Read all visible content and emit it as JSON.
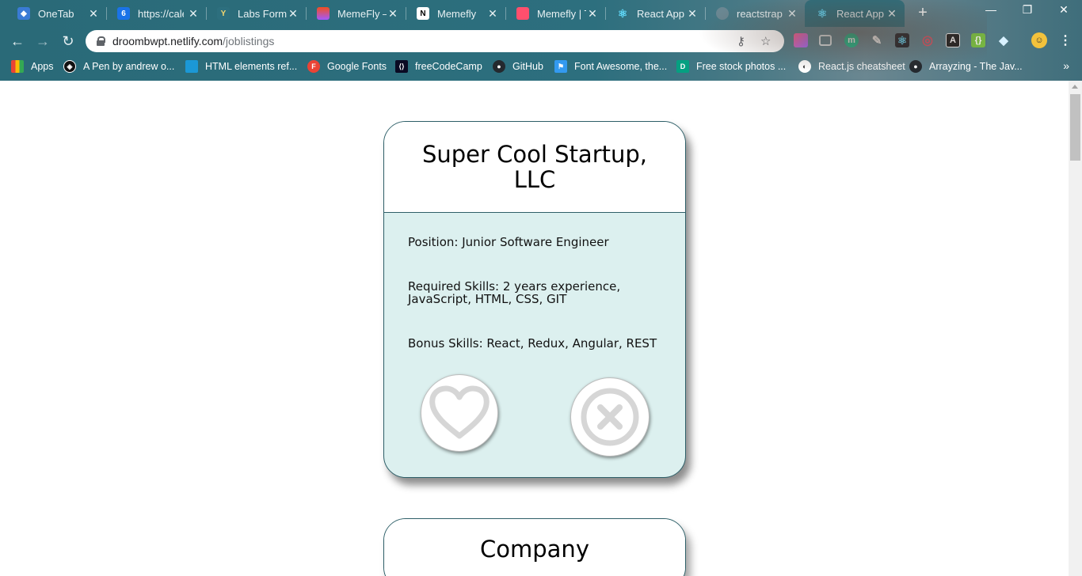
{
  "browser": {
    "tabs": [
      {
        "title": "OneTab",
        "icon": "onetab-icon",
        "color": "#3a7bd5"
      },
      {
        "title": "https://cale",
        "icon": "calendar-icon",
        "color": "#1a73e8",
        "glyph": "6"
      },
      {
        "title": "Labs Forms",
        "icon": "typeform-icon",
        "color": "#2d6f7e",
        "glyph": "Y"
      },
      {
        "title": "MemeFly –",
        "icon": "figma-icon",
        "color": "#e24b2b"
      },
      {
        "title": "Memefly",
        "icon": "notion-icon",
        "color": "#ffffff",
        "glyph": "N"
      },
      {
        "title": "Memefly | T",
        "icon": "trello-icon",
        "color": "#ff4f6d"
      },
      {
        "title": "React App",
        "icon": "react-icon",
        "color": "#61dafb"
      },
      {
        "title": "reactstrap -",
        "icon": "reactstrap-icon",
        "color": "#6a8792"
      },
      {
        "title": "React App",
        "icon": "react-icon",
        "color": "#61dafb"
      }
    ],
    "url_host": "droombwpt.netlify.com",
    "url_path": "/joblistings",
    "bookmarks": [
      {
        "label": "Apps",
        "icon": "apps-grid-icon",
        "color": "#ea4335"
      },
      {
        "label": "A Pen by andrew o...",
        "icon": "codepen-icon",
        "color": "#111111"
      },
      {
        "label": "HTML elements ref...",
        "icon": "mdn-icon",
        "color": "#1b98d6"
      },
      {
        "label": "Google Fonts",
        "icon": "google-fonts-icon",
        "color": "#ea4335",
        "glyph": "F"
      },
      {
        "label": "freeCodeCamp",
        "icon": "freecodecamp-icon",
        "color": "#0a0a23"
      },
      {
        "label": "GitHub",
        "icon": "github-icon",
        "color": "#24292e"
      },
      {
        "label": "Font Awesome, the...",
        "icon": "font-awesome-icon",
        "color": "#339af0"
      },
      {
        "label": "Free stock photos ...",
        "icon": "pexels-icon",
        "color": "#05a081",
        "glyph": "D"
      },
      {
        "label": "React.js cheatsheet",
        "icon": "globe-icon",
        "color": "#5f6368"
      },
      {
        "label": "Arrayzing - The Jav...",
        "icon": "github-icon",
        "color": "#24292e"
      }
    ]
  },
  "cards": [
    {
      "company": "Super Cool Startup, LLC",
      "position": "Position: Junior Software Engineer",
      "required": "Required Skills: 2 years experience, JavaScript, HTML, CSS, GIT",
      "bonus": "Bonus Skills: React, Redux, Angular, REST"
    },
    {
      "company": "Company"
    }
  ],
  "colors": {
    "card_body": "#dcf0ef",
    "card_border": "#2e5f68",
    "icon_gray": "#d6d6d6"
  }
}
